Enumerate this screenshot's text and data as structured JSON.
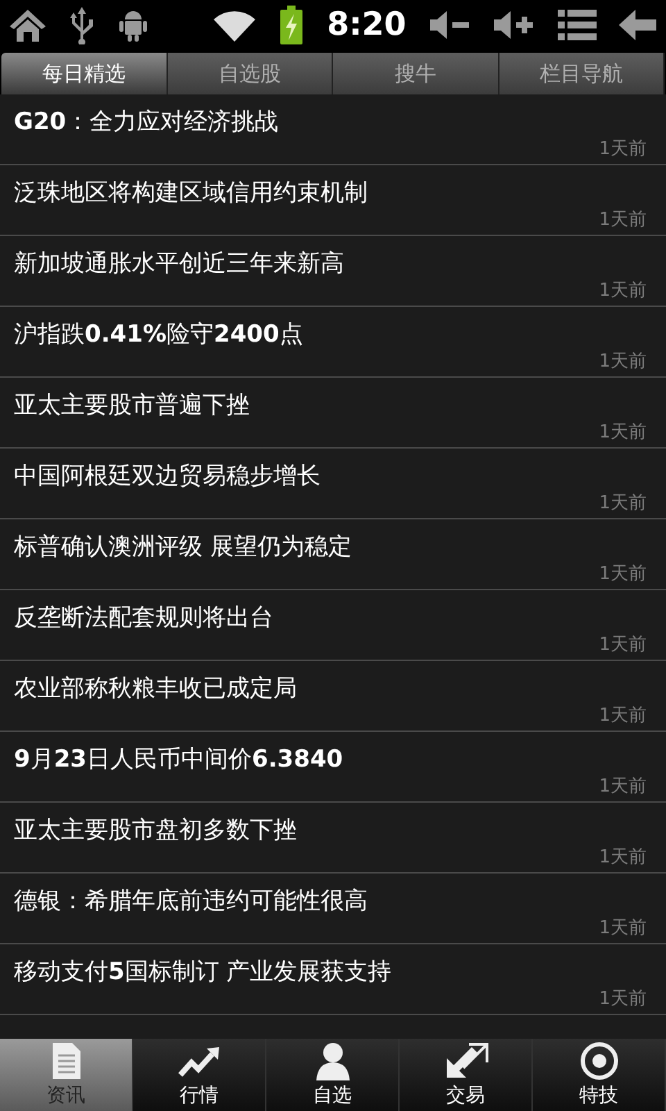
{
  "status_bar": {
    "time": "8:20"
  },
  "tabs": [
    {
      "label": "每日精选",
      "selected": true
    },
    {
      "label": "自选股",
      "selected": false
    },
    {
      "label": "搜牛",
      "selected": false
    },
    {
      "label": "栏目导航",
      "selected": false
    }
  ],
  "news": [
    {
      "title": "**G20**：全力应对经济挑战",
      "time": "1天前"
    },
    {
      "title": "泛珠地区将构建区域信用约束机制",
      "time": "1天前"
    },
    {
      "title": "新加坡通胀水平创近三年来新高",
      "time": "1天前"
    },
    {
      "title": "沪指跌**0.41%**险守**2400**点",
      "time": "1天前"
    },
    {
      "title": "亚太主要股市普遍下挫",
      "time": "1天前"
    },
    {
      "title": "中国阿根廷双边贸易稳步增长",
      "time": "1天前"
    },
    {
      "title": "标普确认澳洲评级 展望仍为稳定",
      "time": "1天前"
    },
    {
      "title": "反垄断法配套规则将出台",
      "time": "1天前"
    },
    {
      "title": "农业部称秋粮丰收已成定局",
      "time": "1天前"
    },
    {
      "title": "**9**月**23**日人民币中间价**6.3840**",
      "time": "1天前"
    },
    {
      "title": "亚太主要股市盘初多数下挫",
      "time": "1天前"
    },
    {
      "title": "德银：希腊年底前违约可能性很高",
      "time": "1天前"
    },
    {
      "title": "移动支付**5**国标制订 产业发展获支持",
      "time": "1天前"
    }
  ],
  "bottom_nav": [
    {
      "label": "资讯",
      "kind": "document",
      "selected": true
    },
    {
      "label": "行情",
      "kind": "trend",
      "selected": false
    },
    {
      "label": "自选",
      "kind": "person",
      "selected": false
    },
    {
      "label": "交易",
      "kind": "exchange",
      "selected": false
    },
    {
      "label": "特技",
      "kind": "target",
      "selected": false
    }
  ]
}
